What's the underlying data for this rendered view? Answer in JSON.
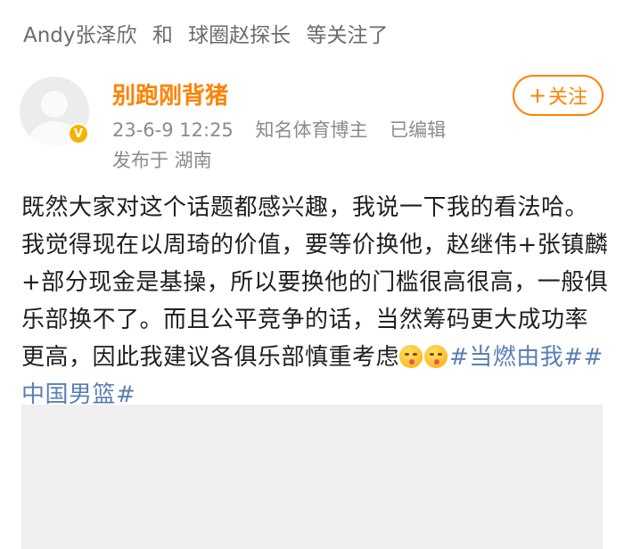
{
  "liked_by": {
    "user1": "Andy张泽欣",
    "connector": "和",
    "user2": "球圈赵探长",
    "suffix": "等关注了"
  },
  "post": {
    "author_name": "别跑刚背猪",
    "badge_icon": "v-verified-icon",
    "timestamp": "23-6-9 12:25",
    "author_title": "知名体育博主",
    "edited_label": "已编辑",
    "location": "发布于 湖南",
    "follow_label": "关注",
    "text": "既然大家对这个话题都感兴趣，我说一下我的看法哈。我觉得现在以周琦的价值，要等价换他，赵继伟+张镇麟+部分现金是基操，所以要换他的门槛很高很高，一般俱乐部换不了。而且公平竞争的话，当然筹码更大成功率更高，因此我建议各俱乐部慎重考虑",
    "emojis": [
      "kiss-emoji",
      "kiss-emoji"
    ],
    "topics": [
      "#当燃由我#",
      "#中国男篮#"
    ]
  },
  "colors": {
    "accent": "#ff8200",
    "topic": "#5b7fb4",
    "muted": "#8b8b8b"
  }
}
